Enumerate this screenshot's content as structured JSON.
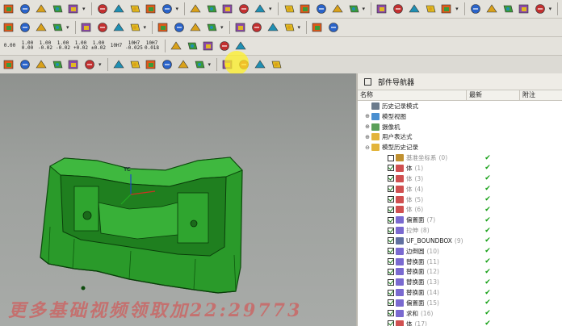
{
  "toolbar": {
    "rows": [
      {
        "icons": [
          "color-tool-icon",
          "rotate-icon",
          "palette-icon",
          "wrench-icon",
          "layer-icon",
          "shade-icon",
          "gear-icon",
          "cube-icon",
          "box-icon",
          "sheet-icon",
          "photo-icon",
          "book-icon",
          "cylinder-icon",
          "loop-icon",
          "arrows-icon",
          "plane-icon",
          "drop-icon",
          "eye-icon",
          "sphere-icon",
          "cubeplus-icon",
          "stack-icon",
          "chain-icon",
          "wire-icon",
          "frame-icon",
          "flag-icon",
          "view-icon",
          "diamond-icon",
          "mirror-icon",
          "cut-icon",
          "bolt-icon"
        ]
      },
      {
        "icons": [
          "part-icon",
          "shape-icon",
          "scale-icon",
          "curve-icon",
          "link-icon",
          "bar-icon",
          "tag-icon",
          "cursor-icon",
          "mark-icon",
          "triangle-icon",
          "board-icon",
          "target-icon",
          "lens-icon",
          "brush-icon",
          "slab-icon",
          "hash-icon",
          "tree-icon",
          "gauge-icon"
        ]
      },
      {
        "items": [
          "0.00",
          "1.00",
          "1.00",
          "1.00",
          "1.00",
          "1.00",
          "10H7",
          "10H7",
          "10H7"
        ]
      },
      {
        "icons": [
          "select-icon",
          "filter-icon",
          "move-icon",
          "snap-icon",
          "eye2-icon",
          "grid-icon",
          "point-icon",
          "endpoint-icon",
          "midpoint-icon",
          "control-icon",
          "intersect-icon",
          "center-icon",
          "quadrant-icon",
          "onpoint-icon",
          "tangent-icon",
          "planar-icon"
        ]
      }
    ],
    "labels": {
      "row2_right": "10H7",
      "row3_sizes": [
        "0.00",
        "1.00\n0.00",
        "1.00\n-0.02",
        "1.00\n-0.02",
        "1.00\n+0.02",
        "1.00\n±0.02",
        "10H7",
        "10H7\n-0.025",
        "10H7\n0.018"
      ]
    }
  },
  "navigator": {
    "title": "部件导航器",
    "columns": [
      "名称",
      "最新",
      "附注"
    ],
    "rows": [
      {
        "indent": 0,
        "exp": "",
        "icon": "clock-icon",
        "label": "历史记录模式",
        "num": "",
        "check": false,
        "tick": false,
        "dim": false
      },
      {
        "indent": 0,
        "exp": "⊕",
        "icon": "view-icon",
        "label": "模型视图",
        "num": "",
        "check": false,
        "tick": false,
        "dim": false
      },
      {
        "indent": 0,
        "exp": "⊕",
        "icon": "camera-icon",
        "label": "摄像机",
        "num": "",
        "check": false,
        "tick": false,
        "dim": false
      },
      {
        "indent": 0,
        "exp": "⊕",
        "icon": "folder-icon",
        "label": "用户表达式",
        "num": "",
        "check": false,
        "tick": false,
        "dim": false
      },
      {
        "indent": 0,
        "exp": "⊖",
        "icon": "folder-icon",
        "label": "模型历史记录",
        "num": "",
        "check": false,
        "tick": false,
        "dim": false
      },
      {
        "indent": 1,
        "exp": "",
        "icon": "datum-icon",
        "label": "基准坐标系",
        "num": "(0)",
        "check": false,
        "tick": true,
        "dim": true
      },
      {
        "indent": 1,
        "exp": "",
        "icon": "body-icon",
        "label": "体",
        "num": "(1)",
        "check": true,
        "tick": true,
        "dim": false
      },
      {
        "indent": 1,
        "exp": "",
        "icon": "body-icon",
        "label": "体",
        "num": "(3)",
        "check": true,
        "tick": true,
        "dim": true
      },
      {
        "indent": 1,
        "exp": "",
        "icon": "body-icon",
        "label": "体",
        "num": "(4)",
        "check": true,
        "tick": true,
        "dim": true
      },
      {
        "indent": 1,
        "exp": "",
        "icon": "body-icon",
        "label": "体",
        "num": "(5)",
        "check": true,
        "tick": true,
        "dim": true
      },
      {
        "indent": 1,
        "exp": "",
        "icon": "body-icon",
        "label": "体",
        "num": "(6)",
        "check": true,
        "tick": true,
        "dim": true
      },
      {
        "indent": 1,
        "exp": "",
        "icon": "face-icon",
        "label": "偏置面",
        "num": "(7)",
        "check": true,
        "tick": true,
        "dim": false
      },
      {
        "indent": 1,
        "exp": "",
        "icon": "face-icon",
        "label": "拉伸",
        "num": "(8)",
        "check": true,
        "tick": true,
        "dim": true
      },
      {
        "indent": 1,
        "exp": "",
        "icon": "box-icon",
        "label": "UF_BOUNDBOX",
        "num": "(9)",
        "check": true,
        "tick": true,
        "dim": false
      },
      {
        "indent": 1,
        "exp": "",
        "icon": "face-icon",
        "label": "边倒圆",
        "num": "(10)",
        "check": true,
        "tick": true,
        "dim": false
      },
      {
        "indent": 1,
        "exp": "",
        "icon": "face-icon",
        "label": "替换面",
        "num": "(11)",
        "check": true,
        "tick": true,
        "dim": false
      },
      {
        "indent": 1,
        "exp": "",
        "icon": "face-icon",
        "label": "替换面",
        "num": "(12)",
        "check": true,
        "tick": true,
        "dim": false
      },
      {
        "indent": 1,
        "exp": "",
        "icon": "face-icon",
        "label": "替换面",
        "num": "(13)",
        "check": true,
        "tick": true,
        "dim": false
      },
      {
        "indent": 1,
        "exp": "",
        "icon": "face-icon",
        "label": "替换面",
        "num": "(14)",
        "check": true,
        "tick": true,
        "dim": false
      },
      {
        "indent": 1,
        "exp": "",
        "icon": "face-icon",
        "label": "偏置面",
        "num": "(15)",
        "check": true,
        "tick": true,
        "dim": false
      },
      {
        "indent": 1,
        "exp": "",
        "icon": "face-icon",
        "label": "求和",
        "num": "(16)",
        "check": true,
        "tick": true,
        "dim": false
      },
      {
        "indent": 1,
        "exp": "",
        "icon": "body-icon",
        "label": "体",
        "num": "(17)",
        "check": true,
        "tick": true,
        "dim": false
      }
    ]
  },
  "viewport": {
    "axis_label": "YC",
    "model_color": "#2a9a2a"
  },
  "watermark": "更多基础视频领取加22:29773",
  "colors": {
    "accent_green": "#16a016",
    "cursor_highlight": "#fff028"
  }
}
